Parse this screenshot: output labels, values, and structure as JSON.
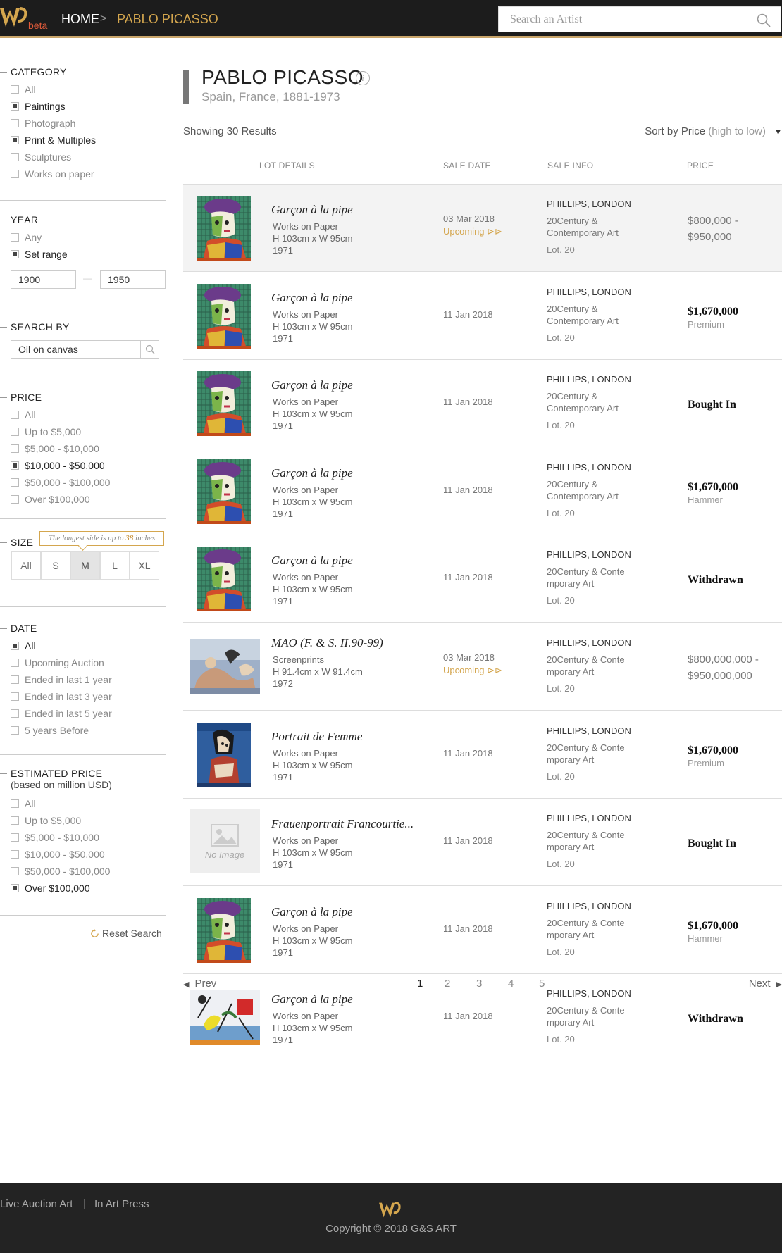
{
  "header": {
    "logo_beta": "beta",
    "home": "HOME",
    "separator": ">",
    "current": "PABLO PICASSO",
    "search_placeholder": "Search an Artist"
  },
  "filters": {
    "category": {
      "title": "CATEGORY",
      "options": [
        {
          "label": "All",
          "checked": false
        },
        {
          "label": "Paintings",
          "checked": true
        },
        {
          "label": "Photograph",
          "checked": false
        },
        {
          "label": "Print & Multiples",
          "checked": true
        },
        {
          "label": "Sculptures",
          "checked": false
        },
        {
          "label": "Works on paper",
          "checked": false
        }
      ]
    },
    "year": {
      "title": "YEAR",
      "options": [
        {
          "label": "Any",
          "checked": false
        },
        {
          "label": "Set range",
          "checked": true
        }
      ],
      "from": "1900",
      "to": "1950",
      "dash": "—"
    },
    "search_by": {
      "title": "SEARCH BY",
      "value": "Oil on canvas"
    },
    "price": {
      "title": "PRICE",
      "options": [
        {
          "label": "All",
          "checked": false
        },
        {
          "label": "Up to $5,000",
          "checked": false
        },
        {
          "label": "$5,000 - $10,000",
          "checked": false
        },
        {
          "label": "$10,000 - $50,000",
          "checked": true
        },
        {
          "label": "$50,000 - $100,000",
          "checked": false
        },
        {
          "label": "Over $100,000",
          "checked": false
        }
      ]
    },
    "size": {
      "title": "SIZE",
      "tooltip_pre": "The longest side is up to ",
      "tooltip_num": "38",
      "tooltip_post": " inches",
      "options": [
        "All",
        "S",
        "M",
        "L",
        "XL"
      ],
      "selected": "M"
    },
    "date": {
      "title": "DATE",
      "options": [
        {
          "label": "All",
          "checked": true
        },
        {
          "label": "Upcoming Auction",
          "checked": false
        },
        {
          "label": "Ended in last 1 year",
          "checked": false
        },
        {
          "label": "Ended in last 3 year",
          "checked": false
        },
        {
          "label": "Ended in last 5 year",
          "checked": false
        },
        {
          "label": "5 years Before",
          "checked": false
        }
      ]
    },
    "estimated": {
      "title": "ESTIMATED PRICE",
      "subtitle": "(based on million USD)",
      "options": [
        {
          "label": "All",
          "checked": false
        },
        {
          "label": "Up to $5,000",
          "checked": false
        },
        {
          "label": "$5,000 - $10,000",
          "checked": false
        },
        {
          "label": "$10,000 - $50,000",
          "checked": false
        },
        {
          "label": "$50,000 - $100,000",
          "checked": false
        },
        {
          "label": "Over $100,000",
          "checked": true
        }
      ]
    },
    "reset": "Reset Search"
  },
  "artist": {
    "name": "PABLO PICASSO",
    "info_icon": "i",
    "subtitle": "Spain, France, 1881-1973"
  },
  "results": {
    "showing": "Showing 30 Results",
    "sort_label": "Sort by Price",
    "sort_value": "(high to low)",
    "columns": [
      "LOT DETAILS",
      "SALE DATE",
      "SALE INFO",
      "PRICE"
    ]
  },
  "lots": [
    {
      "title": "Garçon à la pipe",
      "medium": "Works on Paper",
      "dims": "H 103cm x W 95cm",
      "year": "1971",
      "date": "03 Mar 2018",
      "upcoming": "Upcoming ⊳⊳",
      "house": "PHILLIPS, LONDON",
      "sale": "20Century & Contemporary Art",
      "lot": "Lot. 20",
      "price": "$800,000 - $950,000",
      "note": "",
      "big": false,
      "img": "picasso"
    },
    {
      "title": "Garçon à la pipe",
      "medium": "Works on Paper",
      "dims": "H 103cm x W 95cm",
      "year": "1971",
      "date": "11 Jan 2018",
      "upcoming": "",
      "house": "PHILLIPS, LONDON",
      "sale": "20Century & Contemporary Art",
      "lot": "Lot. 20",
      "price": "$1,670,000",
      "note": "Premium",
      "big": true,
      "img": "picasso"
    },
    {
      "title": "Garçon à la pipe",
      "medium": "Works on Paper",
      "dims": "H 103cm x W 95cm",
      "year": "1971",
      "date": "11 Jan 2018",
      "upcoming": "",
      "house": "PHILLIPS, LONDON",
      "sale": "20Century & Contemporary Art",
      "lot": "Lot. 20",
      "price": "Bought In",
      "note": "",
      "big": true,
      "img": "picasso"
    },
    {
      "title": "Garçon à la pipe",
      "medium": "Works on Paper",
      "dims": "H 103cm x W 95cm",
      "year": "1971",
      "date": "11 Jan 2018",
      "upcoming": "",
      "house": "PHILLIPS, LONDON",
      "sale": "20Century & Contemporary Art",
      "lot": "Lot. 20",
      "price": "$1,670,000",
      "note": "Hammer",
      "big": true,
      "img": "picasso"
    },
    {
      "title": "Garçon à la pipe",
      "medium": "Works on Paper",
      "dims": "H 103cm x W 95cm",
      "year": "1971",
      "date": "11 Jan 2018",
      "upcoming": "",
      "house": "PHILLIPS, LONDON",
      "sale": "20Century & Conte mporary Art",
      "lot": "Lot. 20",
      "price": "Withdrawn",
      "note": "",
      "big": true,
      "img": "picasso"
    },
    {
      "title": "MAO (F. & S. II.90-99)",
      "medium": "Screenprints",
      "dims": "H 91.4cm x W 91.4cm",
      "year": "1972",
      "date": "03 Mar 2018",
      "upcoming": "Upcoming ⊳⊳",
      "house": "PHILLIPS, LONDON",
      "sale": "20Century & Conte mporary Art",
      "lot": "Lot. 20",
      "price": "$800,000,000 - $950,000,000",
      "note": "",
      "big": false,
      "img": "mao"
    },
    {
      "title": "Portrait de Femme",
      "medium": "Works on Paper",
      "dims": "H 103cm x W 95cm",
      "year": "1971",
      "date": "11 Jan 2018",
      "upcoming": "",
      "house": "PHILLIPS, LONDON",
      "sale": "20Century & Conte mporary Art",
      "lot": "Lot. 20",
      "price": "$1,670,000",
      "note": "Premium",
      "big": true,
      "img": "femme"
    },
    {
      "title": "Frauenportrait Francourtie...",
      "medium": "Works on Paper",
      "dims": "H 103cm x W 95cm",
      "year": "1971",
      "date": "11 Jan 2018",
      "upcoming": "",
      "house": "PHILLIPS, LONDON",
      "sale": "20Century & Conte mporary Art",
      "lot": "Lot. 20",
      "price": "Bought In",
      "note": "",
      "big": true,
      "img": "none",
      "noimg": "No Image"
    },
    {
      "title": "Garçon à la pipe",
      "medium": "Works on Paper",
      "dims": "H 103cm x W 95cm",
      "year": "1971",
      "date": "11 Jan 2018",
      "upcoming": "",
      "house": "PHILLIPS, LONDON",
      "sale": "20Century & Conte mporary Art",
      "lot": "Lot. 20",
      "price": "$1,670,000",
      "note": "Hammer",
      "big": true,
      "img": "picasso"
    },
    {
      "title": "Garçon à la pipe",
      "medium": "Works on Paper",
      "dims": "H 103cm x W 95cm",
      "year": "1971",
      "date": "11 Jan 2018",
      "upcoming": "",
      "house": "PHILLIPS, LONDON",
      "sale": "20Century & Conte mporary Art",
      "lot": "Lot. 20",
      "price": "Withdrawn",
      "note": "",
      "big": true,
      "img": "miro"
    }
  ],
  "pagination": {
    "prev": "Prev",
    "next": "Next",
    "pages": [
      "1",
      "2",
      "3",
      "4",
      "5"
    ],
    "current": "1"
  },
  "footer": {
    "link1": "Live Auction Art",
    "divider": "|",
    "link2": "In Art Press",
    "copyright": "Copyright © 2018 G&S ART"
  },
  "colors": {
    "accent": "#d4a64e",
    "header_bg": "#1c1c1c",
    "footer_bg": "#232323",
    "beta": "#e05a3a"
  }
}
